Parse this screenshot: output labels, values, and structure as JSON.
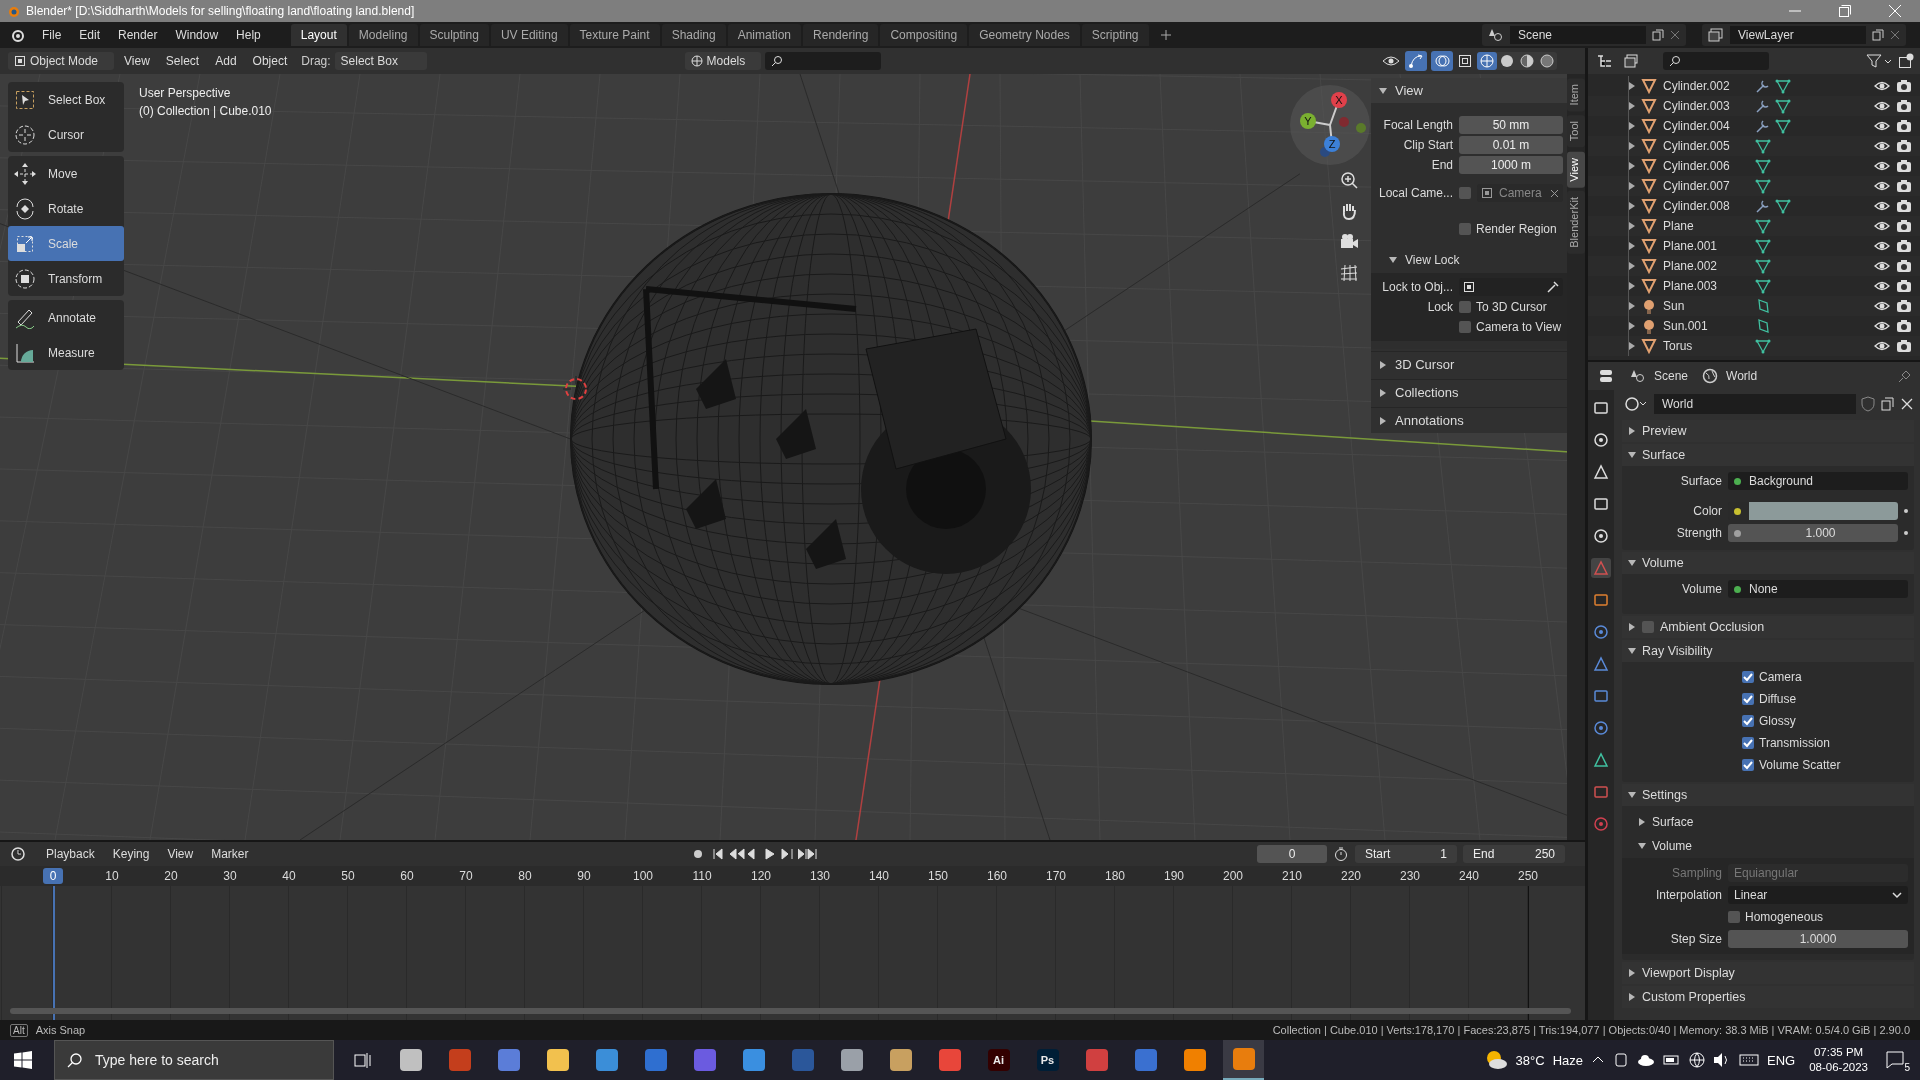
{
  "window": {
    "title": "Blender* [D:\\Siddharth\\Models for selling\\floating land\\floating land.blend]"
  },
  "menu": [
    "File",
    "Edit",
    "Render",
    "Window",
    "Help"
  ],
  "workspaces": [
    {
      "label": "Layout",
      "selected": true
    },
    {
      "label": "Modeling",
      "selected": false
    },
    {
      "label": "Sculpting",
      "selected": false
    },
    {
      "label": "UV Editing",
      "selected": false
    },
    {
      "label": "Texture Paint",
      "selected": false
    },
    {
      "label": "Shading",
      "selected": false
    },
    {
      "label": "Animation",
      "selected": false
    },
    {
      "label": "Rendering",
      "selected": false
    },
    {
      "label": "Compositing",
      "selected": false
    },
    {
      "label": "Geometry Nodes",
      "selected": false
    },
    {
      "label": "Scripting",
      "selected": false
    }
  ],
  "scene": "Scene",
  "view_layer": "ViewLayer",
  "viewport_header": {
    "mode": "Object Mode",
    "menus": [
      "View",
      "Select",
      "Add",
      "Object"
    ],
    "drag_label": "Drag:",
    "drag_value": "Select Box",
    "orientation": "Models"
  },
  "tool_groups": [
    [
      {
        "label": "Select Box",
        "kind": "select",
        "selected": false
      },
      {
        "label": "Cursor",
        "kind": "cursor",
        "selected": false
      }
    ],
    [
      {
        "label": "Move",
        "kind": "move",
        "selected": false
      },
      {
        "label": "Rotate",
        "kind": "rotate",
        "selected": false
      },
      {
        "label": "Scale",
        "kind": "scale",
        "selected": true
      },
      {
        "label": "Transform",
        "kind": "transform",
        "selected": false
      }
    ],
    [
      {
        "label": "Annotate",
        "kind": "annotate",
        "selected": false
      },
      {
        "label": "Measure",
        "kind": "measure",
        "selected": false
      }
    ]
  ],
  "viewport_info": [
    "User Perspective",
    "(0) Collection | Cube.010"
  ],
  "gizmo_axes": [
    "X",
    "Y",
    "Z"
  ],
  "shading_modes": [
    {
      "kind": "wireframe",
      "selected": true
    },
    {
      "kind": "solid",
      "selected": false
    },
    {
      "kind": "material",
      "selected": false
    },
    {
      "kind": "rendered",
      "selected": false
    }
  ],
  "sidebar_tabs": [
    {
      "label": "Item",
      "selected": false
    },
    {
      "label": "Tool",
      "selected": false
    },
    {
      "label": "View",
      "selected": true
    },
    {
      "label": "BlenderKit",
      "selected": false
    }
  ],
  "view_panel": {
    "title": "View",
    "expanded": true,
    "fields": [
      {
        "label": "Focal Length",
        "value": "50 mm"
      },
      {
        "label": "Clip Start",
        "value": "0.01 m"
      },
      {
        "label": "End",
        "value": "1000 m"
      }
    ],
    "local_camera": {
      "label": "Local Came...",
      "checked": false,
      "placeholder": "Camera"
    },
    "render_region": {
      "label": "Render Region",
      "checked": false
    },
    "view_lock": {
      "title": "View Lock",
      "expanded": true,
      "lock_to_object": "Lock to Obj...",
      "lock_label": "Lock",
      "options": [
        {
          "label": "To 3D Cursor",
          "checked": false
        },
        {
          "label": "Camera to View",
          "checked": false
        }
      ]
    }
  },
  "sidebar_sections": [
    {
      "title": "3D Cursor",
      "expanded": false
    },
    {
      "title": "Collections",
      "expanded": false
    },
    {
      "title": "Annotations",
      "expanded": false
    }
  ],
  "outliner": [
    {
      "name": "Cylinder.002",
      "kind": "mesh",
      "modifier": true
    },
    {
      "name": "Cylinder.003",
      "kind": "mesh",
      "modifier": true
    },
    {
      "name": "Cylinder.004",
      "kind": "mesh",
      "modifier": true
    },
    {
      "name": "Cylinder.005",
      "kind": "mesh",
      "modifier": false
    },
    {
      "name": "Cylinder.006",
      "kind": "mesh",
      "modifier": false
    },
    {
      "name": "Cylinder.007",
      "kind": "mesh",
      "modifier": false
    },
    {
      "name": "Cylinder.008",
      "kind": "mesh",
      "modifier": true
    },
    {
      "name": "Plane",
      "kind": "mesh",
      "modifier": false
    },
    {
      "name": "Plane.001",
      "kind": "mesh",
      "modifier": false
    },
    {
      "name": "Plane.002",
      "kind": "mesh",
      "modifier": false
    },
    {
      "name": "Plane.003",
      "kind": "mesh",
      "modifier": false
    },
    {
      "name": "Sun",
      "kind": "light",
      "modifier": false
    },
    {
      "name": "Sun.001",
      "kind": "light",
      "modifier": false
    },
    {
      "name": "Torus",
      "kind": "mesh",
      "modifier": false
    }
  ],
  "properties": {
    "tabs": [
      "Scene",
      "World"
    ],
    "world_name": "World",
    "panels": [
      {
        "kind": "plain",
        "title": "Preview",
        "expanded": false
      },
      {
        "kind": "rows",
        "title": "Surface",
        "expanded": true,
        "rows": [
          {
            "kind": "link",
            "label": "Surface",
            "value": "Background"
          },
          {
            "kind": "color",
            "label": "Color",
            "color": "#8c9a9a"
          },
          {
            "kind": "number",
            "label": "Strength",
            "value": "1.000"
          }
        ]
      },
      {
        "kind": "rows",
        "title": "Volume",
        "expanded": true,
        "rows": [
          {
            "kind": "link",
            "label": "Volume",
            "value": "None"
          }
        ]
      },
      {
        "kind": "check",
        "title": "Ambient Occlusion",
        "expanded": false,
        "checked": false
      },
      {
        "kind": "options",
        "title": "Ray Visibility",
        "expanded": true,
        "options": [
          {
            "label": "Camera",
            "checked": true
          },
          {
            "label": "Diffuse",
            "checked": true
          },
          {
            "label": "Glossy",
            "checked": true
          },
          {
            "label": "Transmission",
            "checked": true
          },
          {
            "label": "Volume Scatter",
            "checked": true
          }
        ]
      },
      {
        "kind": "settings",
        "title": "Settings",
        "expanded": true,
        "subsections": [
          {
            "title": "Surface",
            "expanded": false
          },
          {
            "title": "Volume",
            "expanded": true
          }
        ],
        "sampling": {
          "label": "Sampling",
          "value": "Equiangular",
          "disabled": true
        },
        "interpolation": {
          "label": "Interpolation",
          "value": "Linear"
        },
        "homogeneous": {
          "label": "Homogeneous",
          "checked": false
        },
        "step_size": {
          "label": "Step Size",
          "value": "1.0000"
        }
      },
      {
        "kind": "plain",
        "title": "Viewport Display",
        "expanded": false
      },
      {
        "kind": "plain",
        "title": "Custom Properties",
        "expanded": false
      }
    ]
  },
  "timeline": {
    "menus": [
      "Playback",
      "Keying",
      "View",
      "Marker"
    ],
    "current_frame": "0",
    "start_label": "Start",
    "start": "1",
    "end_label": "End",
    "end": "250",
    "playhead": "0",
    "ruler": [
      "10",
      "20",
      "30",
      "40",
      "50",
      "60",
      "70",
      "80",
      "90",
      "100",
      "110",
      "120",
      "130",
      "140",
      "150",
      "160",
      "170",
      "180",
      "190",
      "200",
      "210",
      "220",
      "230",
      "240",
      "250"
    ]
  },
  "status_bar": {
    "key": "Alt",
    "hint": "Axis Snap",
    "stats": "Collection | Cube.010 | Verts:178,170 | Faces:23,875 | Tris:194,077 | Objects:0/40 | Memory: 38.3 MiB | VRAM: 0.5/4.0 GiB | 2.90.0"
  },
  "taskbar": {
    "search_placeholder": "Type here to search",
    "apps": [
      {
        "color": "#c0c0c0"
      },
      {
        "color": "#c43e1c"
      },
      {
        "color": "#5b7dd8"
      },
      {
        "color": "#f2c14e"
      },
      {
        "color": "#3b8ed8"
      },
      {
        "color": "#2f6fd0"
      },
      {
        "color": "#6b5be0"
      },
      {
        "color": "#3a8fe0"
      },
      {
        "color": "#2b579a"
      },
      {
        "color": "#9aa0a8"
      },
      {
        "color": "#c8a060"
      },
      {
        "color": "#e8463a"
      },
      {
        "color": "#330000",
        "label": "Ai"
      },
      {
        "color": "#001e36",
        "label": "Ps"
      },
      {
        "color": "#d04040"
      },
      {
        "color": "#3a70d0"
      },
      {
        "color": "#f08000"
      },
      {
        "color": "#e87d0d"
      }
    ],
    "temperature": "38°C",
    "weather": "Haze",
    "language": "ENG",
    "time": "07:35 PM",
    "date": "08-06-2023",
    "notifications": "5"
  }
}
